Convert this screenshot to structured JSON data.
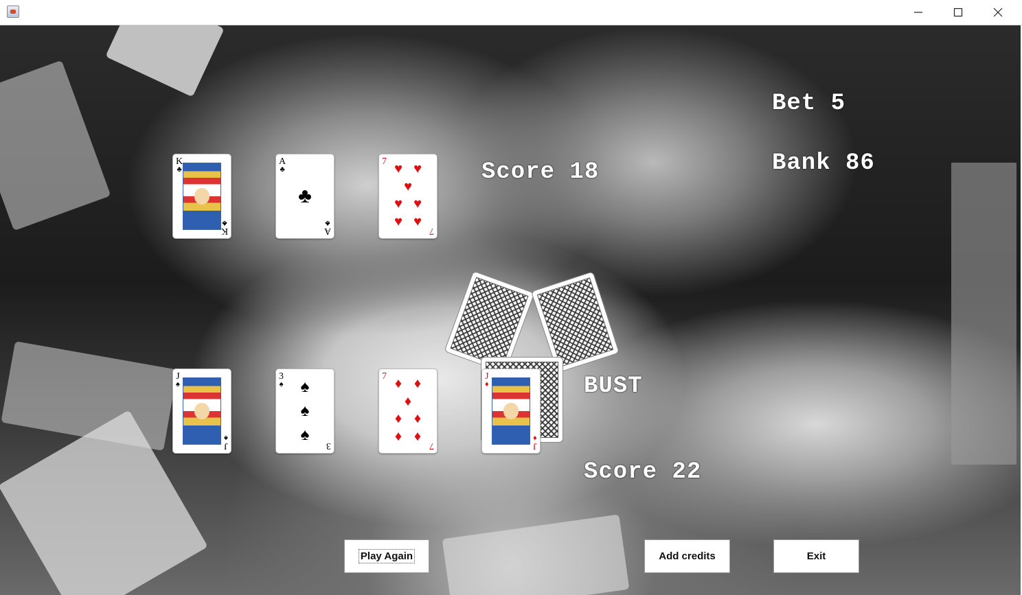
{
  "window": {
    "title": "",
    "controls": [
      "minimize-icon",
      "maximize-icon",
      "close-icon"
    ]
  },
  "dealer": {
    "cards": [
      {
        "rank": "K",
        "suit": "♣",
        "color": "black"
      },
      {
        "rank": "A",
        "suit": "♣",
        "color": "black"
      },
      {
        "rank": "7",
        "suit": "♥",
        "color": "red"
      }
    ],
    "score_text": "Score 18"
  },
  "player": {
    "cards": [
      {
        "rank": "J",
        "suit": "♠",
        "color": "black"
      },
      {
        "rank": "3",
        "suit": "♠",
        "color": "black"
      },
      {
        "rank": "7",
        "suit": "♦",
        "color": "red"
      },
      {
        "rank": "J",
        "suit": "♦",
        "color": "red"
      }
    ],
    "status": "BUST",
    "score_text": "Score 22"
  },
  "bet_text": "Bet 5",
  "bank_text": "Bank 86",
  "buttons": {
    "play_again": "Play Again",
    "add_credits": "Add credits",
    "exit": "Exit"
  }
}
